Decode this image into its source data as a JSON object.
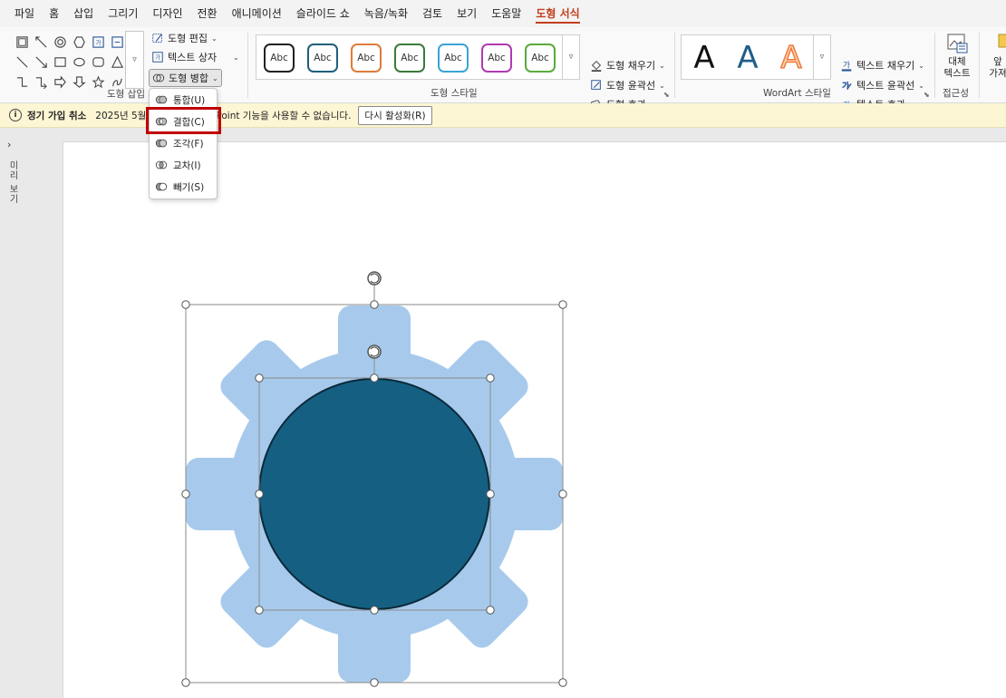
{
  "menu": {
    "tabs": [
      "파일",
      "홈",
      "삽입",
      "그리기",
      "디자인",
      "전환",
      "애니메이션",
      "슬라이드 쇼",
      "녹음/녹화",
      "검토",
      "보기",
      "도움말",
      "도형 서식"
    ],
    "active_tab": "도형 서식"
  },
  "ribbon": {
    "insert_shapes": {
      "label": "도형 삽입",
      "edit_shape": "도형 편집",
      "text_box": "텍스트 상자",
      "merge_shapes": "도형 병합"
    },
    "shape_styles": {
      "label": "도형 스타일",
      "sample_text": "Abc",
      "colors": [
        "#222222",
        "#1f5f7a",
        "#e07b39",
        "#3a7a3a",
        "#3ba3d6",
        "#b03ab0",
        "#5aaa3a"
      ],
      "fill": "도형 채우기",
      "outline": "도형 윤곽선",
      "effects": "도형 효과"
    },
    "wordart": {
      "label": "WordArt 스타일",
      "letters": [
        "A",
        "A",
        "A"
      ],
      "colors": [
        "#111111",
        "#1f5f8a",
        "#f07a3a"
      ],
      "text_fill": "텍스트 채우기",
      "text_outline": "텍스트 윤곽선",
      "text_effects": "텍스트 효과"
    },
    "accessibility": {
      "label": "접근성",
      "alt_text_line1": "대체",
      "alt_text_line2": "텍스트"
    },
    "arrange": {
      "partial_line1": "앞",
      "partial_line2": "가져"
    }
  },
  "notice": {
    "title": "정기 가입 취소",
    "message": "2025년 5월 대부분의 PowerPoint 기능을 사용할 수 없습니다.",
    "button": "다시 활성화(R)"
  },
  "left_rail": {
    "label": "미리 보기"
  },
  "merge_menu": {
    "items": [
      "통합(U)",
      "결합(C)",
      "조각(F)",
      "교차(I)",
      "빼기(S)"
    ],
    "highlighted": "결합(C)"
  },
  "colors": {
    "gear_fill": "#a7caec",
    "circle_fill": "#156082",
    "accent": "#c43e1c",
    "highlight_box": "#c00000"
  }
}
